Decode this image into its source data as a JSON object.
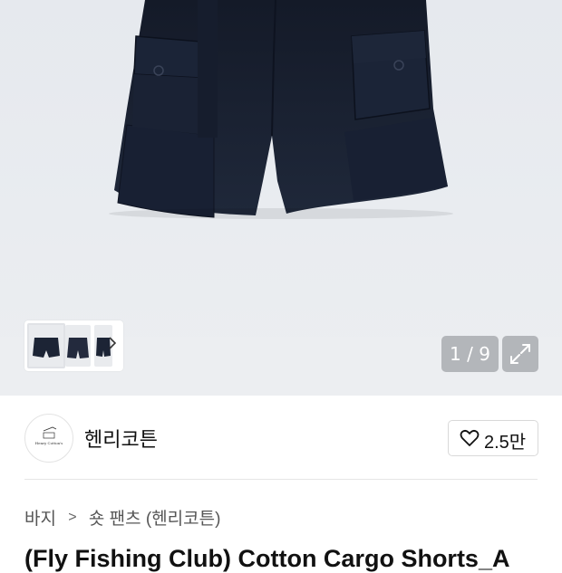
{
  "gallery": {
    "page_counter": "1 / 9",
    "thumbnail_count": 3
  },
  "brand": {
    "logo_text": "Henry Cotton's",
    "name": "헨리코튼"
  },
  "like": {
    "count": "2.5만"
  },
  "breadcrumb": {
    "items": [
      "바지",
      "숏 팬츠 (헨리코튼)"
    ],
    "separator": ">"
  },
  "product": {
    "title": "(Fly Fishing Club) Cotton Cargo Shorts_A"
  },
  "colors": {
    "background": "#ffffff",
    "hero_bg": "#e9ecf0",
    "product_navy": "#1c2435",
    "overlay": "#8a8e94",
    "text_primary": "#111111",
    "text_secondary": "#555555"
  }
}
